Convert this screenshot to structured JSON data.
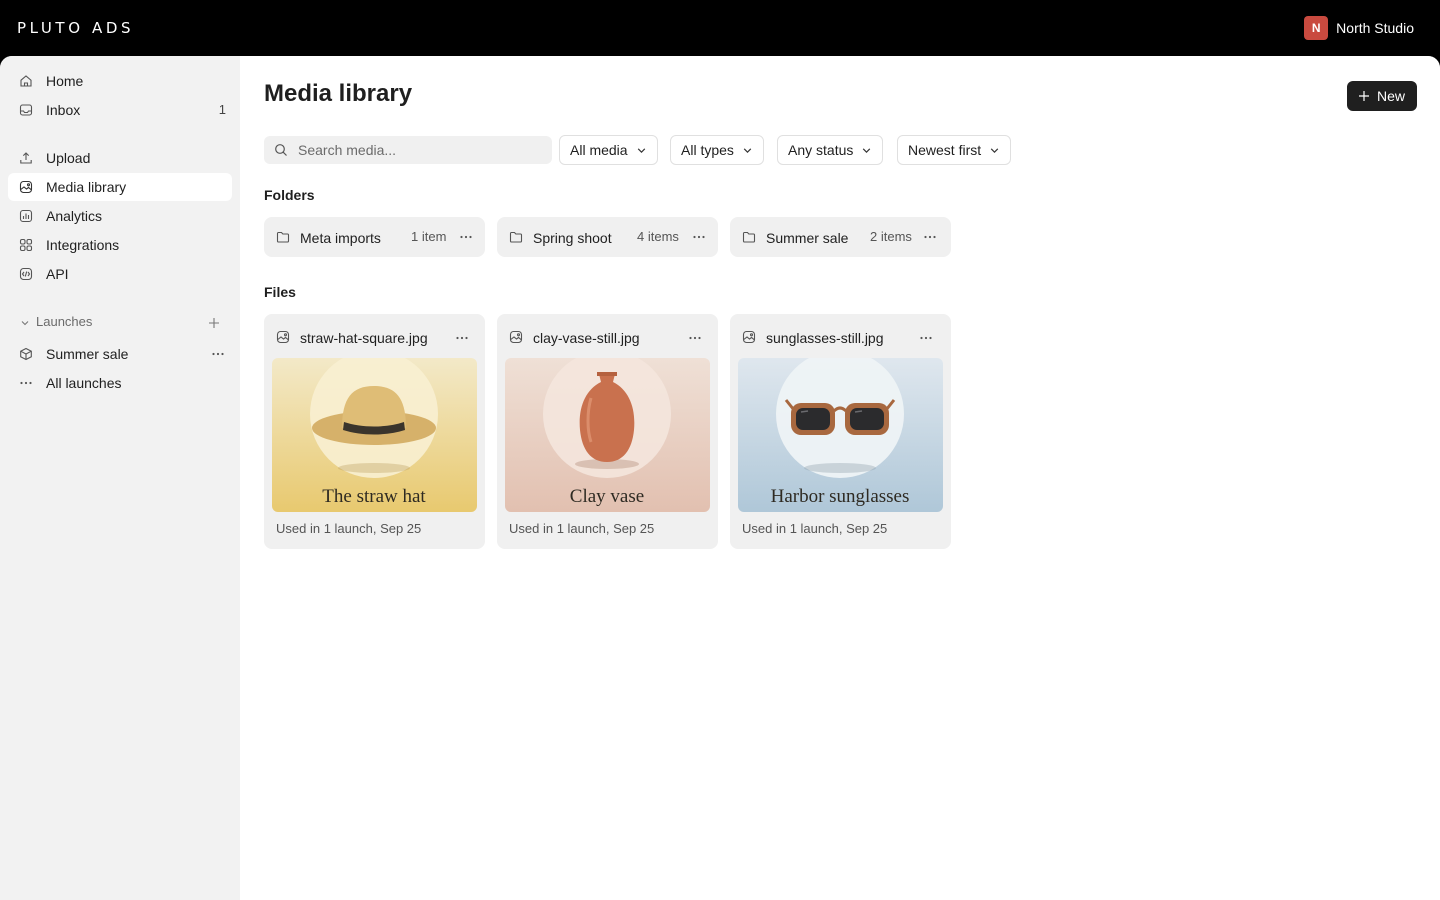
{
  "brand": {
    "name": "PLUTO ADS"
  },
  "account": {
    "initial": "N",
    "name": "North Studio",
    "avatar_color": "#c94a3f"
  },
  "sidebar": {
    "items": [
      {
        "label": "Home",
        "icon": "home-icon"
      },
      {
        "label": "Inbox",
        "icon": "inbox-icon",
        "count": "1"
      },
      {
        "label": "Upload",
        "icon": "upload-icon"
      },
      {
        "label": "Media library",
        "icon": "media-icon",
        "active": true
      },
      {
        "label": "Analytics",
        "icon": "analytics-icon"
      },
      {
        "label": "Integrations",
        "icon": "integrations-icon"
      },
      {
        "label": "API",
        "icon": "api-icon"
      }
    ],
    "launches": {
      "label": "Launches",
      "items": [
        {
          "label": "Summer sale",
          "icon": "box-icon"
        },
        {
          "label": "All launches",
          "icon": "ellipsis-icon"
        }
      ]
    }
  },
  "main": {
    "title": "Media library",
    "new_button": "New",
    "search": {
      "placeholder": "Search media..."
    },
    "filters": [
      "All media",
      "All types",
      "Any status",
      "Newest first"
    ],
    "folders_title": "Folders",
    "folders": [
      {
        "name": "Meta imports",
        "count": "1 item"
      },
      {
        "name": "Spring shoot",
        "count": "4 items"
      },
      {
        "name": "Summer sale",
        "count": "2 items"
      }
    ],
    "files_title": "Files",
    "files": [
      {
        "name": "straw-hat-square.jpg",
        "caption": "The straw hat",
        "meta": "Used in 1 launch, Sep 25",
        "bg_top": "#f3e9c8",
        "bg_bottom": "#e8c96f"
      },
      {
        "name": "clay-vase-still.jpg",
        "caption": "Clay vase",
        "meta": "Used in 1 launch, Sep 25",
        "bg_top": "#efe0d6",
        "bg_bottom": "#e2c0b0"
      },
      {
        "name": "sunglasses-still.jpg",
        "caption": "Harbor sunglasses",
        "meta": "Used in 1 launch, Sep 25",
        "bg_top": "#dfe7ee",
        "bg_bottom": "#afc7d8"
      }
    ]
  }
}
